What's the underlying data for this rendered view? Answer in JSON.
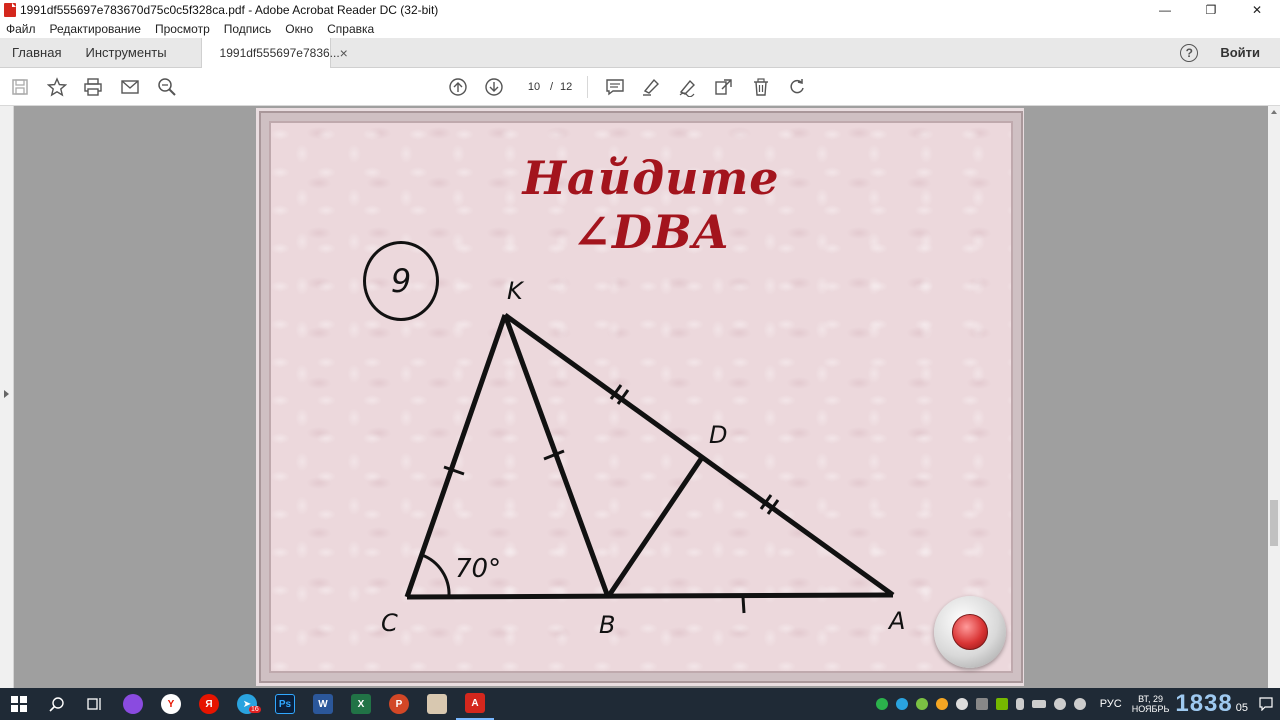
{
  "window": {
    "title": "1991df555697e783670d75c0c5f328ca.pdf - Adobe Acrobat Reader DC (32-bit)",
    "minimize": "—",
    "restore": "❐",
    "close": "✕"
  },
  "menu": [
    "Файл",
    "Редактирование",
    "Просмотр",
    "Подпись",
    "Окно",
    "Справка"
  ],
  "tabs": {
    "home": "Главная",
    "tools": "Инструменты",
    "document": "1991df555697e7836...",
    "close": "×",
    "help": "?",
    "signin": "Войти"
  },
  "toolbar": {
    "current_page": "10",
    "page_separator": "/",
    "total_pages": "12"
  },
  "slide": {
    "title": "Найдите ∠DBA",
    "problem_number": "9",
    "labels": {
      "k": "K",
      "d": "D",
      "c": "C",
      "b": "B",
      "a": "A",
      "angle": "70°"
    }
  },
  "taskbar": {
    "telegram_badge": "16",
    "language": "РУС",
    "day": "ВТ, 29",
    "month": "НОЯБРЬ",
    "time": "1838",
    "seconds": "05"
  },
  "colors": {
    "title_red": "#a3141d",
    "slide_bg": "#ecd8dc",
    "taskbar_bg": "#1f2a36"
  }
}
